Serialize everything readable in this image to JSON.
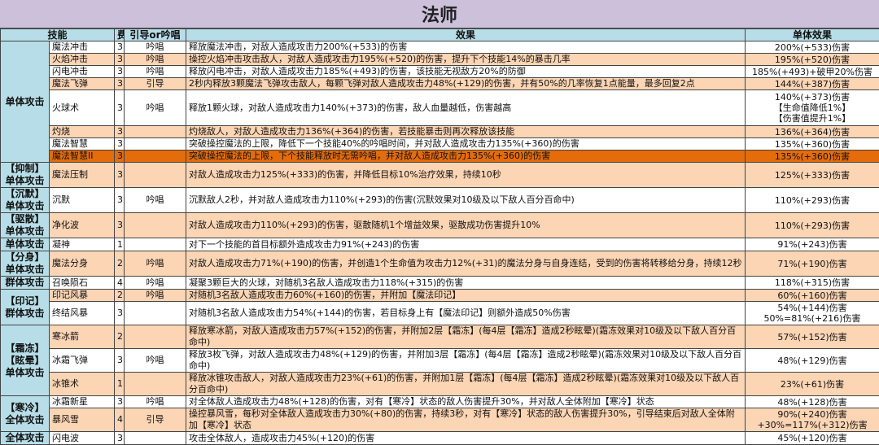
{
  "title": "法师",
  "headers": {
    "skill": "技能",
    "fee": "费",
    "mode": "引导or吟唱",
    "effect": "效果",
    "single": "单体效果"
  },
  "colors": {
    "title_bg": "#ccc0da",
    "header_bg": "#b7dee8",
    "orange": "#fcd5b4",
    "dark_orange": "#e46c0a"
  },
  "groups": [
    {
      "label": "单体攻击",
      "rows": [
        {
          "name": "魔法冲击",
          "fee": "3",
          "mode": "吟唱",
          "effect": "释放魔法冲击，对敌人造成攻击力200%(+533)的伤害",
          "single": "200%(+533)伤害",
          "tone": "w",
          "h": 15
        },
        {
          "name": "火焰冲击",
          "fee": "3",
          "mode": "吟唱",
          "effect": "操控火焰冲击攻击敌人，对敌人造成攻击力195%(+520)的伤害，提升下个技能14%的暴击几率",
          "single": "195%(+520)伤害",
          "tone": "o",
          "h": 15
        },
        {
          "name": "闪电冲击",
          "fee": "3",
          "mode": "吟唱",
          "effect": "释放闪电冲击，对敌人造成攻击力185%(+493)的伤害，该技能无视敌方20%的防御",
          "single": "185%(+493)+破甲20%伤害",
          "tone": "w",
          "h": 15
        },
        {
          "name": "魔法飞弹",
          "fee": "3",
          "mode": "引导",
          "effect": "2秒内释放3颗魔法飞弹攻击敌人，每颗飞弹对敌人造成攻击力48%(+129)的伤害，并有50%的几率恢复1点能量，最多回复2点",
          "single": "144%(+387)伤害",
          "tone": "o",
          "h": 15
        },
        {
          "name": "火球术",
          "fee": "3",
          "mode": "吟唱",
          "effect": "释放1颗火球，对敌人造成攻击力140%(+373)的伤害，敌人血量越低，伤害越高",
          "single": "140%(+373)伤害\n【生命值降低1%】\n【伤害值提升1%】",
          "tone": "w",
          "h": 45
        },
        {
          "name": "灼烧",
          "fee": "3",
          "mode": "",
          "effect": "灼烧敌人，对敌人造成攻击力136%(+364)的伤害，若技能暴击则再次释放该技能",
          "single": "136%(+364)伤害",
          "tone": "o",
          "h": 15
        },
        {
          "name": "魔法智慧",
          "fee": "3",
          "mode": "",
          "effect": "突破操控魔法的上限，降低下一个技能40%的吟唱时间，并对敌人造成攻击力135%(+360)的伤害",
          "single": "135%(+360)伤害",
          "tone": "w",
          "h": 15
        },
        {
          "name": "魔法智慧II",
          "fee": "3",
          "mode": "",
          "effect": "突破操控魔法的上限，下个技能释放时无需吟唱，并对敌人造成攻击力135%(+360)的伤害",
          "single": "135%(+360)伤害",
          "tone": "d",
          "h": 15
        }
      ]
    },
    {
      "label": "【抑制】单体攻击",
      "rows": [
        {
          "name": "魔法压制",
          "fee": "3",
          "mode": "",
          "effect": "对敌人造成攻击力125%(+333)的伤害，并降低目标10%治疗效果，持续10秒",
          "single": "125%(+333)伤害",
          "tone": "o",
          "h": 30
        }
      ]
    },
    {
      "label": "【沉默】单体攻击",
      "rows": [
        {
          "name": "沉默",
          "fee": "3",
          "mode": "吟唱",
          "effect": "沉默敌人2秒，并对敌人造成攻击力110%(+293)的伤害(沉默效果对10级及以下敌人百分百命中)",
          "single": "110%(+293)伤害",
          "tone": "w",
          "h": 30
        }
      ]
    },
    {
      "label": "【驱散】单体攻击",
      "rows": [
        {
          "name": "净化波",
          "fee": "3",
          "mode": "",
          "effect": "对敌人造成攻击力110%(+293)的伤害，驱散随机1个增益效果，驱散成功伤害提升10%",
          "single": "110%(+293)伤害",
          "tone": "o",
          "h": 30
        }
      ]
    },
    {
      "label": "单体攻击",
      "rows": [
        {
          "name": "凝神",
          "fee": "1",
          "mode": "",
          "effect": "对下一个技能的首目标额外造成攻击力91%(+243)的伤害",
          "single": "91%(+243)伤害",
          "tone": "w",
          "h": 15
        }
      ]
    },
    {
      "label": "【分身】单体攻击",
      "rows": [
        {
          "name": "魔法分身",
          "fee": "2",
          "mode": "吟唱",
          "effect": "对敌人造成攻击力71%(+190)的伤害，并创造1个生命值为攻击力12%(+31)的魔法分身与自身连结，受到的伤害将转移给分身，持续12秒",
          "single": "71%(+190)伤害",
          "tone": "o",
          "h": 30
        }
      ]
    },
    {
      "label": "群体攻击",
      "rows": [
        {
          "name": "召唤陨石",
          "fee": "4",
          "mode": "吟唱",
          "effect": "凝聚3颗巨大的火球，对随机3名敌人造成攻击力118%(+315)的伤害",
          "single": "118%(+315)伤害",
          "tone": "w",
          "h": 15
        }
      ]
    },
    {
      "label": "【印记】群体攻击",
      "rows": [
        {
          "name": "印记风暴",
          "fee": "2",
          "mode": "吟唱",
          "effect": "对随机3名敌人造成攻击力60%(+160)的伤害，并附加【魔法印记】",
          "single": "60%(+160)伤害",
          "tone": "o",
          "h": 15
        },
        {
          "name": "终结风暴",
          "fee": "3",
          "mode": "",
          "effect": "对随机3名敌人造成攻击力54%(+144)的伤害，若目标身上有【魔法印记】则额外造成50%伤害",
          "single": "54%(+144)伤害\n50%=81%(+216)伤害",
          "tone": "w",
          "h": 30
        }
      ]
    },
    {
      "label": "【霜冻】【眩晕】单体攻击",
      "rows": [
        {
          "name": "寒冰箭",
          "fee": "2",
          "mode": "",
          "effect": "释放寒冰箭，对敌人造成攻击力57%(+152)的伤害，并附加2层【霜冻】(每4层【霜冻】造成2秒眩晕)(霜冻效果对10级及以下敌人百分百命中)",
          "single": "57%(+152)伤害",
          "tone": "o",
          "h": 30
        },
        {
          "name": "冰霜飞弹",
          "fee": "3",
          "mode": "吟唱",
          "effect": "释放3枚飞弹，对敌人造成攻击力48%(+129)的伤害，并附加3层【霜冻】(每4层【霜冻】造成2秒眩晕)(霜冻效果对10级及以下敌人百分百命中)",
          "single": "48%(+129)伤害",
          "tone": "w",
          "h": 30
        },
        {
          "name": "冰锥术",
          "fee": "1",
          "mode": "",
          "effect": "释放冰锥攻击敌人，对敌人造成攻击力23%(+61)的伤害，并附加1层【霜冻】(每4层【霜冻】造成2秒眩晕)(霜冻效果对10级及以下敌人百分百命中)",
          "single": "23%(+61)伤害",
          "tone": "o",
          "h": 30
        }
      ]
    },
    {
      "label": "【寒冷】全体攻击",
      "rows": [
        {
          "name": "冰霜新星",
          "fee": "3",
          "mode": "吟唱",
          "effect": "对全体敌人造成攻击力48%(+128)的伤害，对有【寒冷】状态的敌人伤害提升30%，并对敌人全体附加【寒冷】状态",
          "single": "48%(+128)伤害",
          "tone": "w",
          "h": 15
        },
        {
          "name": "暴风雪",
          "fee": "4",
          "mode": "引导",
          "effect": "操控暴风雪，每秒对全体敌人造成攻击力30%(+80)的伤害，持续3秒，对有【寒冷】状态的敌人伤害提升30%，引导结束后对敌人全体附加【寒冷】状态",
          "single": "90%(+240)伤害\n+30%=117%(+312)伤害",
          "tone": "o",
          "h": 30
        }
      ]
    },
    {
      "label": "全体攻击",
      "rows": [
        {
          "name": "闪电波",
          "fee": "3",
          "mode": "",
          "effect": "攻击全体敌人，造成攻击力45%(+120)的伤害",
          "single": "45%(+120)伤害",
          "tone": "w",
          "h": 15
        }
      ]
    }
  ]
}
